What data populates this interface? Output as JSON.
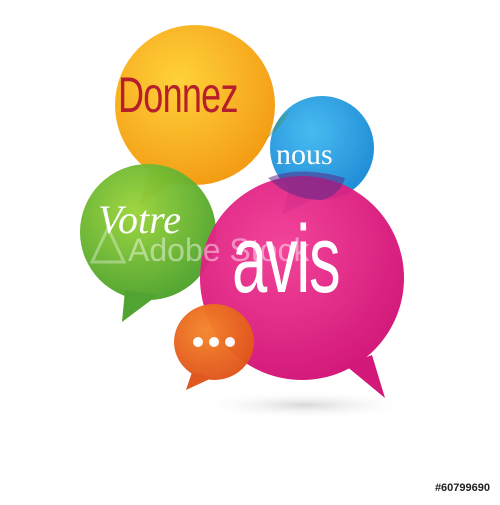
{
  "headline": {
    "word1": "Donnez",
    "word2": "nous",
    "word3": "Votre",
    "word4": "avis"
  },
  "watermark": "Adobe Stock",
  "stock_id": "#60799690",
  "colors": {
    "yellow_bubble": "#f7a81b",
    "blue_bubble": "#1a9be0",
    "green_bubble": "#6ab82e",
    "pink_bubble": "#e6127f",
    "orange_bubble": "#ef6a1c",
    "donnez_text": "#b51e2a"
  }
}
